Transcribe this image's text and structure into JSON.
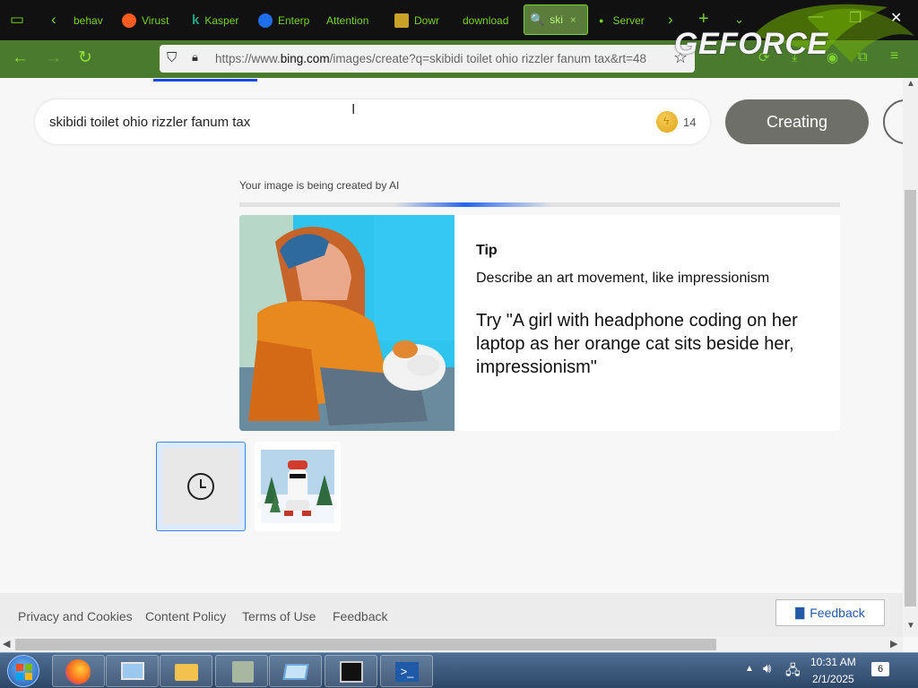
{
  "tabs": [
    {
      "label": "behav",
      "icon": "generic"
    },
    {
      "label": "Virust",
      "icon": "reddit"
    },
    {
      "label": "Kasper",
      "icon": "kaspersky"
    },
    {
      "label": "Enterp",
      "icon": "generic"
    },
    {
      "label": "Attention",
      "icon": "none"
    },
    {
      "label": "Dowr",
      "icon": "generic"
    },
    {
      "label": "download",
      "icon": "none"
    },
    {
      "label": "ski",
      "icon": "search",
      "active": true
    },
    {
      "label": "Server",
      "icon": "dot"
    }
  ],
  "address_bar": {
    "url_prefix": "https://www.",
    "url_domain": "bing.com",
    "url_rest": "/images/create?q=skibidi toilet ohio rizzler fanum tax&rt=48"
  },
  "overlay_logo": "GEFORCE",
  "search": {
    "query": "skibidi toilet ohio rizzler fanum tax",
    "boost_count": "14",
    "create_label": "Creating"
  },
  "status_text": "Your image is being created by AI",
  "progress": {
    "start": 0.26,
    "end": 0.52
  },
  "tip": {
    "title": "Tip",
    "description": "Describe an art movement, like impressionism",
    "example": "Try \"A girl with headphone coding on her laptop as her orange cat sits beside her, impressionism\""
  },
  "footer": {
    "links": [
      "Privacy and Cookies",
      "Content Policy",
      "Terms of Use",
      "Feedback"
    ],
    "feedback_button": "Feedback"
  },
  "taskbar": {
    "time": "10:31 AM",
    "date": "2/1/2025",
    "notification_count": "6"
  },
  "colors": {
    "tab_bar": "#111111",
    "nav_green": "#4a7a2e",
    "accent_blue": "#174ae4",
    "creating_button": "#6f6f69"
  }
}
